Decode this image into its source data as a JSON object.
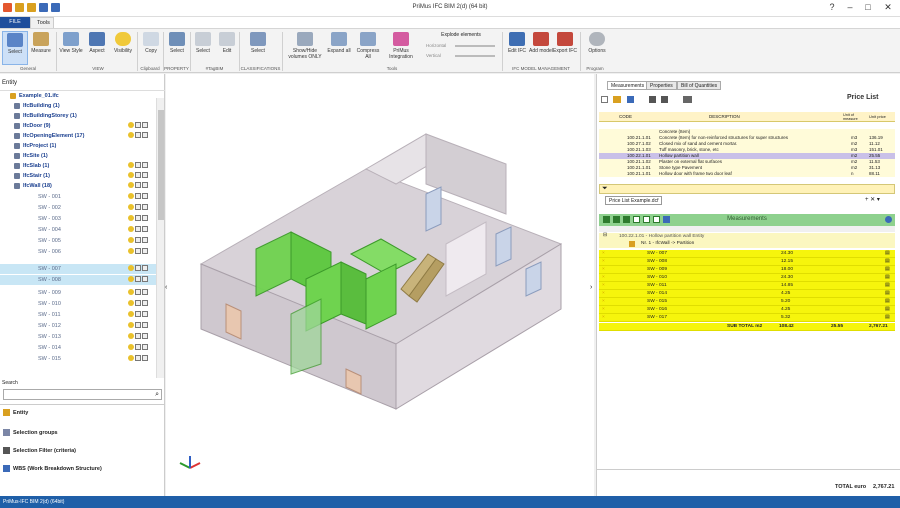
{
  "window": {
    "title": "PriMus IFC BIM 2(d) (64 bit)"
  },
  "tabs": {
    "file": "FILE",
    "tools": "Tools"
  },
  "ribbon": {
    "buttons": [
      "Select",
      "Measure",
      "View Style",
      "Aspect",
      "Visibility",
      "Copy",
      "Select",
      "Select",
      "Edit",
      "Select",
      "Show/Hide volumes ONLY",
      "Expand all",
      "Compress All",
      "PriMus Integration",
      "Edit IFC",
      "Add model",
      "Export IFC",
      "Options"
    ],
    "explode_label": "Explode elements",
    "horizontal": "Horizontal",
    "vertical": "Vertical",
    "groups": [
      "General",
      "VIEW",
      "Clipboard",
      "PROPERTY",
      "#TagBIM",
      "CLASSIFICATIONS",
      "Tools",
      "IFC MODEL MANAGEMENT",
      "Program"
    ]
  },
  "left": {
    "entity_header": "Entity",
    "tree": [
      "Example_01.ifc",
      "IfcBuilding (1)",
      "IfcBuildingStorey (1)",
      "IfcDoor (9)",
      "IfcOpeningElement (17)",
      "IfcProject (1)",
      "IfcSite (1)",
      "IfcSlab (1)",
      "IfcStair (1)",
      "IfcWall (18)"
    ],
    "walls": [
      "SW - 001",
      "SW - 002",
      "SW - 003",
      "SW - 004",
      "SW - 005",
      "SW - 006",
      "SW - 007",
      "SW - 008",
      "SW - 009",
      "SW - 010",
      "SW - 011",
      "SW - 012",
      "SW - 013",
      "SW - 014",
      "SW - 015"
    ],
    "search_label": "Search",
    "panes": [
      "Entity",
      "Selection groups",
      "Selection Filter (criteria)",
      "WBS (Work Breakdown Structure)"
    ]
  },
  "right": {
    "tabs": [
      "Measurements",
      "Properties",
      "Bill of Quantities"
    ],
    "price_list_label": "Price List",
    "price_header": {
      "code": "CODE",
      "desc": "DESCRIPTION",
      "unit": "Unit of measure",
      "price": "Unit price"
    },
    "price_rows": [
      {
        "code": "",
        "desc": "Concrete (Item)",
        "unit": "",
        "price": ""
      },
      {
        "code": "100.21.1.01",
        "desc": "Concrete (Item) for non-reinforced structures for super structures",
        "unit": "m3",
        "price": "136.19"
      },
      {
        "code": "100.27.1.02",
        "desc": "Closed mix of sand and cement mortar.",
        "unit": "m2",
        "price": "11.12"
      },
      {
        "code": "100.21.1.03",
        "desc": "Tuff masonry, brick, stone, etc",
        "unit": "m3",
        "price": "151.01"
      },
      {
        "code": "100.22.1.01",
        "desc": "Hollow partition wall",
        "unit": "m2",
        "price": "25.55"
      },
      {
        "code": "100.21.1.02",
        "desc": "Plaster on external flat surfaces",
        "unit": "m2",
        "price": "11.53"
      },
      {
        "code": "100.21.1.01",
        "desc": "Stone type Pavement",
        "unit": "m2",
        "price": "31.13"
      },
      {
        "code": "100.21.1.01",
        "desc": "Hollow door with frame two door leaf",
        "unit": "n",
        "price": "88.11"
      }
    ],
    "price_footer_tab": "Price List Example.dcf",
    "meas_title": "Measurements",
    "meas_item": "100.22.1.01 - Hollow partition wall Entity",
    "meas_sub": "Nr. 1 - IfcWall -> Partition",
    "meas_rows": [
      {
        "name": "SW - 007",
        "qty": "24.30",
        "total": ""
      },
      {
        "name": "SW - 008",
        "qty": "12.15",
        "total": ""
      },
      {
        "name": "SW - 009",
        "qty": "18.00",
        "total": ""
      },
      {
        "name": "SW - 010",
        "qty": "24.30",
        "total": ""
      },
      {
        "name": "SW - 011",
        "qty": "14.85",
        "total": ""
      },
      {
        "name": "SW - 014",
        "qty": "4.25",
        "total": ""
      },
      {
        "name": "SW - 015",
        "qty": "5.20",
        "total": ""
      },
      {
        "name": "SW - 016",
        "qty": "4.25",
        "total": ""
      },
      {
        "name": "SW - 017",
        "qty": "5.32",
        "total": ""
      }
    ],
    "subtotal_label": "SUB TOTAL m2",
    "subtotal_qty": "108.42",
    "subtotal_price": "25.55",
    "subtotal_amount": "2,767.21",
    "total_label": "TOTAL euro",
    "total_value": "2,767.21"
  },
  "status": {
    "text": "PriMus-IFC BIM 2(d) (64bit)"
  }
}
